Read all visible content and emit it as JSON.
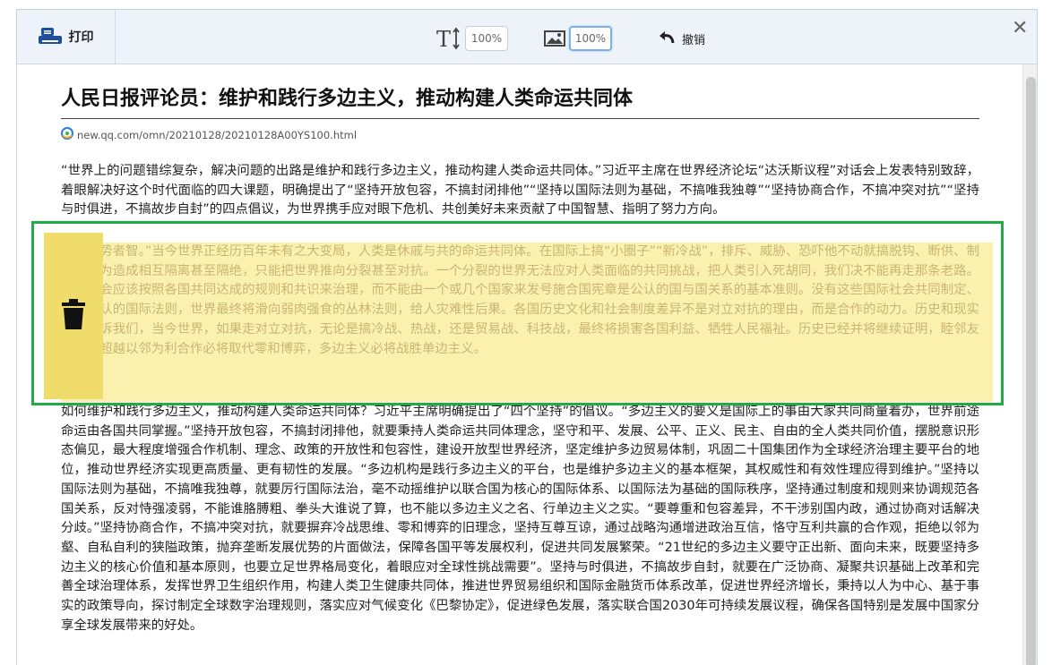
{
  "toolbar": {
    "print_label": "打印",
    "text_zoom": "100%",
    "image_zoom": "100%",
    "undo_label": "撤销",
    "close_glyph": "✕"
  },
  "article": {
    "title": "人民日报评论员：维护和践行多边主义，推动构建人类命运共同体",
    "source_url": "new.qq.com/omn/20210128/20210128A00YS100.html",
    "paragraph1": "“世界上的问题错综复杂，解决问题的出路是维护和践行多边主义，推动构建人类命运共同体。”习近平主席在世界经济论坛“达沃斯议程”对话会上发表特别致辞，着眼解决好这个时代面临的四大课题，明确提出了“坚持开放包容，不搞封闭排他”“坚持以国际法则为基础，不搞唯我独尊”“坚持协商合作，不搞冲突对抗”“坚持与时俱进，不搞故步自封”的四点倡议，为世界携手应对眼下危机、共创美好未来贡献了中国智慧、指明了努力方向。",
    "paragraph2": "明，趋势者智。”当今世界正经历百年未有之大变局，人类是休戚与共的命运共同体。在国际上搞“小圈子”“新冷战”，排斥、威胁、恐吓他不动就搞脱钩、断供、制裁，人为造成相互隔离甚至隔绝，只能把世界推向分裂甚至对抗。一个分裂的世界无法应对人类面临的共同挑战，把人类引入死胡同，我们决不能再走那条老路。国际社会应该按照各国共同达成的规则和共识来治理，而不能由一个或几个国家来发号施合国宪章是公认的国与国关系的基本准则。没有这些国际社会共同制定、普遍公认的国际法则，世界最终将滑向弱肉强食的丛林法则，给人灾难性后果。各国历史文化和社会制度差异不是对立对抗的理由，而是合作的动力。历史和现实一再告诉我们，当今世界，如果走对立对抗，无论是搞冷战、热战，还是贸易战、科技战，最终将损害各国利益、牺牲人民福祉。历史已经并将继续证明，睦邻友好必将超越以邻为利合作必将取代零和博弈，多边主义必将战胜单边主义。",
    "paragraph3": "如何维护和践行多边主义，推动构建人类命运共同体？习近平主席明确提出了“四个坚持”的倡议。“多边主义的要义是国际上的事由大家共同商量着办，世界前途命运由各国共同掌握。”坚持开放包容，不搞封闭排他，就要秉持人类命运共同体理念，坚守和平、发展、公平、正义、民主、自由的全人类共同价值，摆脱意识形态偏见，最大程度增强合作机制、理念、政策的开放性和包容性，建设开放型世界经济，坚定维护多边贸易体制，巩固二十国集团作为全球经济治理主要平台的地位，推动世界经济实现更高质量、更有韧性的发展。“多边机构是践行多边主义的平台，也是维护多边主义的基本框架，其权威性和有效性理应得到维护。”坚持以国际法则为基础，不搞唯我独尊，就要厉行国际法治，毫不动摇维护以联合国为核心的国际体系、以国际法为基础的国际秩序，坚持通过制度和规则来协调规范各国关系，反对恃强凌弱，不能谁胳膊粗、拳头大谁说了算，也不能以多边主义之名、行单边主义之实。“要尊重和包容差异，不干涉别国内政，通过协商对话解决分歧。”坚持协商合作，不搞冲突对抗，就要摒弃冷战思维、零和博弈的旧理念，坚持互尊互谅，通过战略沟通增进政治互信，恪守互利共赢的合作观，拒绝以邻为壑、自私自利的狭隘政策，抛弃垄断发展优势的片面做法，保障各国平等发展权利，促进共同发展繁荣。“21世纪的多边主义要守正出新、面向未来，既要坚持多边主义的核心价值和基本原则，也要立足世界格局变化，着眼应对全球性挑战需要”。坚持与时俱进，不搞故步自封，就要在广泛协商、凝聚共识基础上改革和完善全球治理体系，发挥世界卫生组织作用，构建人类卫生健康共同体，推进世界贸易组织和国际金融货币体系改革，促进世界经济增长，秉持以人为中心、基于事实的政策导向，探讨制定全球数字治理规则，落实应对气候变化《巴黎协定》，促进绿色发展，落实联合国2030年可持续发展议程，确保各国特别是发展中国家分享全球发展带来的好处。"
  },
  "colors": {
    "highlight": "#faeea0",
    "selection_border": "#22aa44",
    "delete_column": "#f0dc6a"
  },
  "icons": [
    "printer-icon",
    "text-size-icon",
    "image-icon",
    "undo-icon",
    "close-icon",
    "trash-icon",
    "source-logo-icon"
  ]
}
